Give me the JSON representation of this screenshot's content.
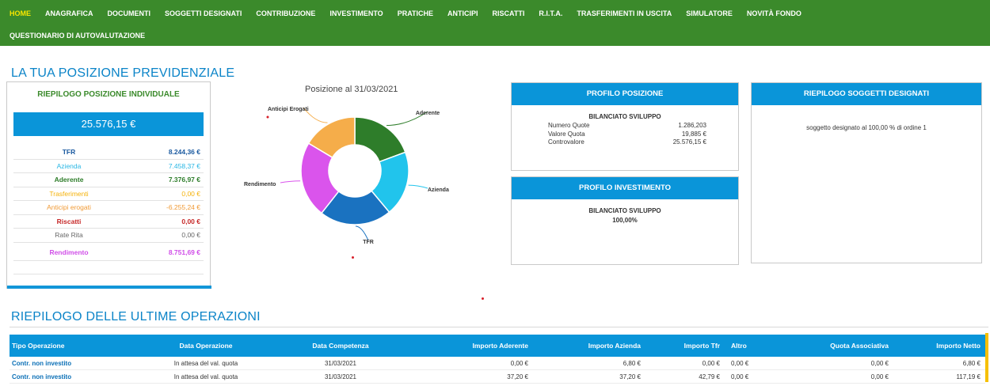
{
  "nav": {
    "row1": [
      "HOME",
      "ANAGRAFICA",
      "DOCUMENTI",
      "SOGGETTI DESIGNATI",
      "CONTRIBUZIONE",
      "INVESTIMENTO",
      "PRATICHE",
      "ANTICIPI",
      "RISCATTI",
      "R.I.T.A.",
      "TRASFERIMENTI IN USCITA",
      "SIMULATORE",
      "NOVITÀ FONDO"
    ],
    "row2": [
      "QUESTIONARIO DI AUTOVALUTAZIONE"
    ],
    "active": "HOME"
  },
  "section1_title": "LA TUA POSIZIONE PREVIDENZIALE",
  "riepilogo": {
    "title": "RIEPILOGO POSIZIONE INDIVIDUALE",
    "total": "25.576,15 €",
    "rows": [
      {
        "label": "TFR",
        "value": "8.244,36 €",
        "color": "#1b5aa0",
        "bold": true
      },
      {
        "label": "Azienda",
        "value": "7.458,37 €",
        "color": "#27b6e4",
        "bold": false
      },
      {
        "label": "Aderente",
        "value": "7.376,97 €",
        "color": "#2e7d2a",
        "bold": true
      },
      {
        "label": "Trasferimenti",
        "value": "0,00 €",
        "color": "#f5b20a",
        "bold": false
      },
      {
        "label": "Anticipi erogati",
        "value": "-6.255,24 €",
        "color": "#f09a35",
        "bold": false
      },
      {
        "label": "Riscatti",
        "value": "0,00 €",
        "color": "#c62828",
        "bold": true
      },
      {
        "label": "Rate Rita",
        "value": "0,00 €",
        "color": "#666666",
        "bold": false
      },
      {
        "label": "Rendimento",
        "value": "8.751,69 €",
        "color": "#d04ee8",
        "bold": true
      }
    ]
  },
  "chart_title": "Posizione al 31/03/2021",
  "chart_data": {
    "type": "pie",
    "title": "Posizione al 31/03/2021",
    "categories": [
      "Aderente",
      "Azienda",
      "TFR",
      "Rendimento",
      "Anticipi Erogati"
    ],
    "values": [
      7376.97,
      7458.37,
      8244.36,
      8751.69,
      6255.24
    ],
    "colors": [
      "#2e7d2a",
      "#21c4ec",
      "#1a72c0",
      "#da54ec",
      "#f5ad4a"
    ]
  },
  "profilo_posizione": {
    "title": "PROFILO POSIZIONE",
    "name": "BILANCIATO SVILUPPO",
    "rows": [
      {
        "label": "Numero Quote",
        "value": "1.286,203"
      },
      {
        "label": "Valore Quota",
        "value": "19,885 €"
      },
      {
        "label": "Controvalore",
        "value": "25.576,15  €"
      }
    ]
  },
  "profilo_investimento": {
    "title": "PROFILO INVESTIMENTO",
    "name": "BILANCIATO SVILUPPO",
    "pct": "100,00%"
  },
  "soggetti": {
    "title": "RIEPILOGO SOGGETTI DESIGNATI",
    "text": "soggetto designato al 100,00  % di ordine 1"
  },
  "section2_title": "RIEPILOGO DELLE ULTIME OPERAZIONI",
  "operazioni": {
    "headers": [
      "Tipo Operazione",
      "Data Operazione",
      "Data Competenza",
      "Importo Aderente",
      "Importo Azienda",
      "Importo Tfr",
      "Altro",
      "Quota Associativa",
      "Importo Netto"
    ],
    "rows": [
      [
        "Contr. non investito",
        "In attesa del val. quota",
        "31/03/2021",
        "0,00 €",
        "6,80 €",
        "0,00 €",
        "0,00 €",
        "0,00 €",
        "6,80 €"
      ],
      [
        "Contr. non investito",
        "In attesa del val. quota",
        "31/03/2021",
        "37,20 €",
        "37,20 €",
        "42,79 €",
        "0,00 €",
        "0,00 €",
        "117,19 €"
      ]
    ]
  }
}
